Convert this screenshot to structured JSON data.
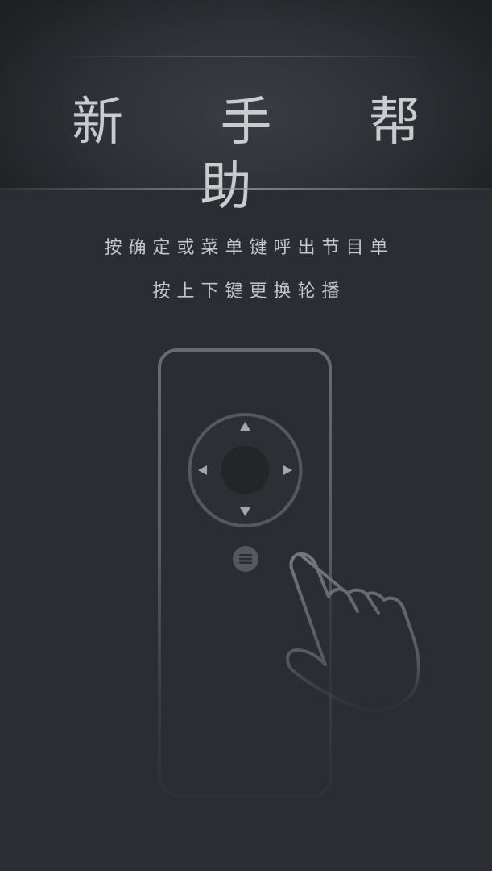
{
  "header": {
    "title": "新 手 帮 助"
  },
  "instructions": {
    "line1": "按确定或菜单键呼出节目单",
    "line2": "按上下键更换轮播"
  },
  "remote": {
    "dpad_up": "up-arrow-icon",
    "dpad_down": "down-arrow-icon",
    "dpad_left": "left-arrow-icon",
    "dpad_right": "right-arrow-icon",
    "center": "ok-button",
    "menu": "menu-icon"
  },
  "colors": {
    "background": "#2a2e32",
    "header_dark": "#1e2124",
    "text": "#c3c6ca",
    "remote_outline": "#5c5f63",
    "dpad_ring": "#56595d",
    "center_button": "#232527",
    "arrow": "#9a9da1",
    "hand_outline": "#6a6d71"
  }
}
